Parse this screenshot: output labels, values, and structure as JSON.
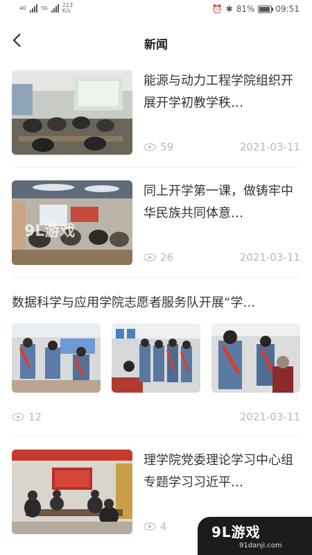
{
  "status_bar": {
    "net_speed": "213",
    "net_unit": "K/s",
    "battery": "81%",
    "battery_level": 0.81,
    "time": "09:51",
    "signal_labels": [
      "4G",
      "5G"
    ]
  },
  "header": {
    "title": "新闻"
  },
  "news": [
    {
      "title": "能源与动力工程学院组织开展开学初教学秩…",
      "views": "59",
      "date": "2021-03-11"
    },
    {
      "title": "同上开学第一课，做铸牢中华民族共同体意…",
      "views": "26",
      "date": "2021-03-11"
    },
    {
      "title": "数据科学与应用学院志愿者服务队开展“学…",
      "views": "12",
      "date": "2021-03-11"
    },
    {
      "title": "理学院党委理论学习中心组专题学习习近平…",
      "views": "4"
    }
  ],
  "watermark": {
    "logo": "9L游戏",
    "site": "91danji.com",
    "overlay": "9L游戏"
  },
  "colors": {
    "accent": "#e03a2c",
    "meta": "#b8b8b8",
    "divider": "#eeeeee"
  }
}
